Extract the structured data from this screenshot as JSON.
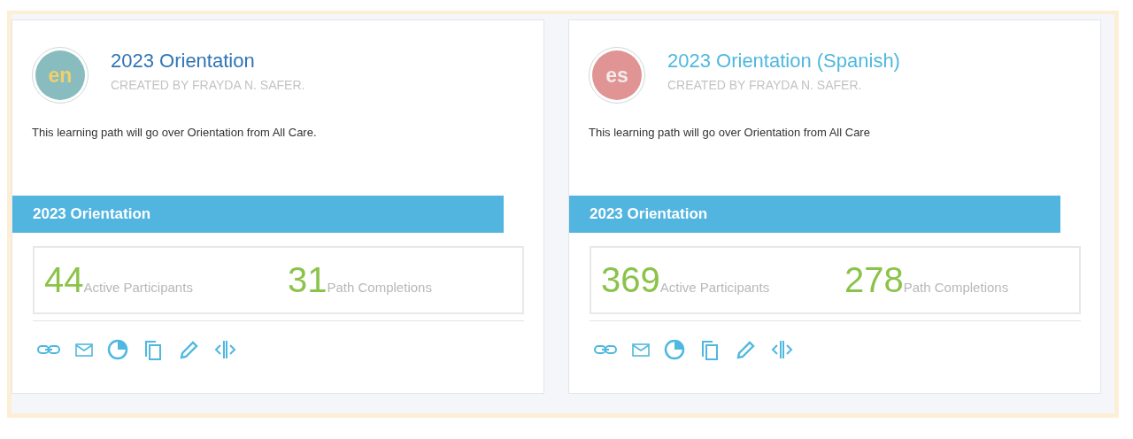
{
  "cards": [
    {
      "avatar": {
        "label": "en",
        "color": "#88bcbf"
      },
      "title": "2023 Orientation",
      "visited": true,
      "created_by": "CREATED BY FRAYDA N. SAFER.",
      "description": "This learning path will go over Orientation from All Care.",
      "banner": "2023 Orientation",
      "stats": [
        {
          "value": "44",
          "label": "Active Participants"
        },
        {
          "value": "31",
          "label": "Path Completions"
        }
      ]
    },
    {
      "avatar": {
        "label": "es",
        "color": "#e09494"
      },
      "title": "2023 Orientation (Spanish)",
      "visited": false,
      "created_by": "CREATED BY FRAYDA N. SAFER.",
      "description": "This learning path will go over Orientation from All Care",
      "banner": "2023 Orientation",
      "stats": [
        {
          "value": "369",
          "label": "Active Participants"
        },
        {
          "value": "278",
          "label": "Path Completions"
        }
      ]
    }
  ]
}
